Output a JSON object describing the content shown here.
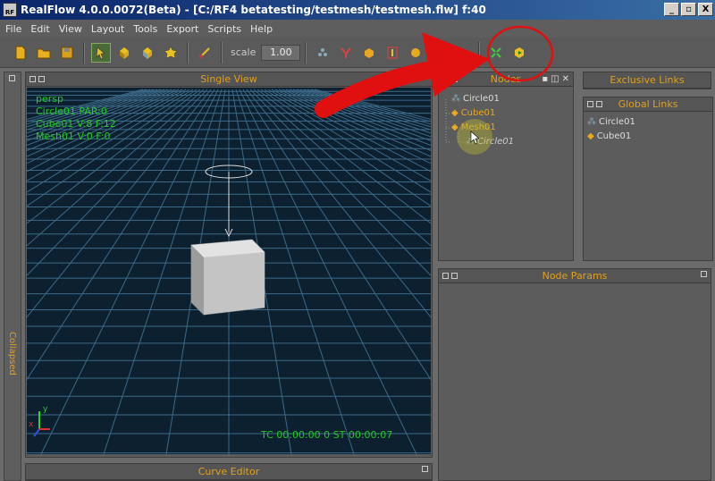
{
  "window": {
    "title": "RealFlow 4.0.0.0072(Beta) - [C:/RF4 betatesting/testmesh/testmesh.flw] f:40",
    "app_icon_text": "RF",
    "controls": [
      "_",
      "▫",
      "X"
    ]
  },
  "menu": [
    "File",
    "Edit",
    "View",
    "Layout",
    "Tools",
    "Export",
    "Scripts",
    "Help"
  ],
  "toolbar": {
    "scale_label": "scale",
    "scale_value": "1.00"
  },
  "left_strip": {
    "label": "Collapsed"
  },
  "single_view": {
    "title": "Single View",
    "info_lines": [
      "persp",
      "Circle01 PAR:0",
      "Cube01 V:8 F:12",
      "Mesh01 V:0 F:0"
    ],
    "timecode": "TC 00:00:00 0  ST 00:00:07",
    "axis": {
      "x": "x",
      "y": "y"
    }
  },
  "nodes": {
    "title": "Nodes",
    "items": [
      "Circle01",
      "Cube01",
      "Mesh01",
      "Circle01"
    ]
  },
  "exclusive_links": {
    "title": "Exclusive Links"
  },
  "global_links": {
    "title": "Global Links",
    "items": [
      "Circle01",
      "Cube01"
    ]
  },
  "node_params": {
    "title": "Node Params"
  },
  "curve_editor": {
    "title": "Curve Editor"
  },
  "colors": {
    "accent_title": "#e0a020",
    "hud_green": "#22cc22",
    "annotation_red": "#e01010"
  }
}
